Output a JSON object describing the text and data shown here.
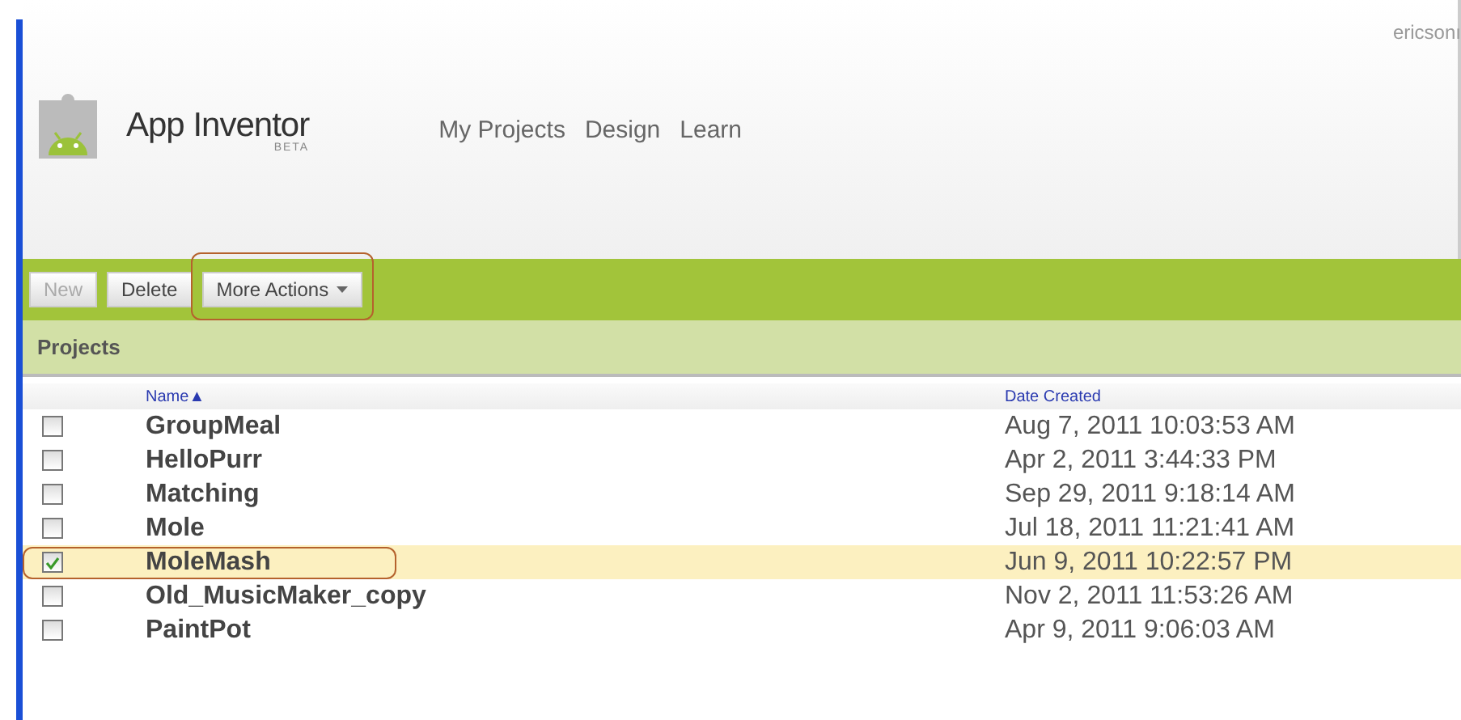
{
  "header": {
    "user": "ericsonı",
    "app_name": "App Inventor",
    "app_badge": "BETA",
    "nav": [
      {
        "label": "My Projects"
      },
      {
        "label": "Design"
      },
      {
        "label": "Learn"
      }
    ]
  },
  "toolbar": {
    "buttons": [
      {
        "label": "New",
        "disabled": true,
        "highlighted": false,
        "kind": "plain"
      },
      {
        "label": "Delete",
        "disabled": false,
        "highlighted": false,
        "kind": "plain"
      },
      {
        "label": "More Actions",
        "disabled": false,
        "highlighted": true,
        "kind": "dropdown"
      }
    ]
  },
  "panel": {
    "title": "Projects"
  },
  "table": {
    "columns": [
      {
        "label": "Name",
        "sort_mark": "▲"
      },
      {
        "label": "Date Created"
      }
    ],
    "rows": [
      {
        "name": "GroupMeal",
        "date": "Aug 7, 2011 10:03:53 AM",
        "checked": false,
        "selected": false,
        "highlighted": false
      },
      {
        "name": "HelloPurr",
        "date": "Apr 2, 2011 3:44:33 PM",
        "checked": false,
        "selected": false,
        "highlighted": false
      },
      {
        "name": "Matching",
        "date": "Sep 29, 2011 9:18:14 AM",
        "checked": false,
        "selected": false,
        "highlighted": false
      },
      {
        "name": "Mole",
        "date": "Jul 18, 2011 11:21:41 AM",
        "checked": false,
        "selected": false,
        "highlighted": false
      },
      {
        "name": "MoleMash",
        "date": "Jun 9, 2011 10:22:57 PM",
        "checked": true,
        "selected": true,
        "highlighted": true
      },
      {
        "name": "Old_MusicMaker_copy",
        "date": "Nov 2, 2011 11:53:26 AM",
        "checked": false,
        "selected": false,
        "highlighted": false
      },
      {
        "name": "PaintPot",
        "date": "Apr 9, 2011 9:06:03 AM",
        "checked": false,
        "selected": false,
        "highlighted": false
      }
    ]
  }
}
